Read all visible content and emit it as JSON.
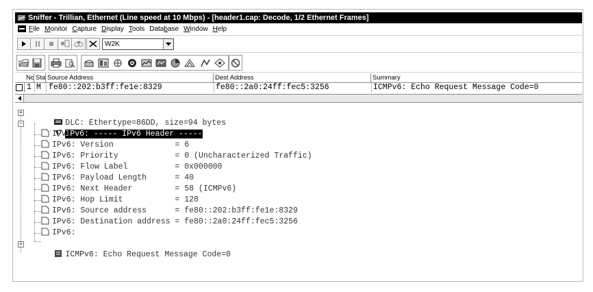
{
  "window": {
    "title": "Sniffer - Trillian, Ethernet (Line speed at 10 Mbps) - [header1.cap: Decode, 1/2 Ethernet Frames]"
  },
  "menu": {
    "items": [
      {
        "label": "File",
        "u": "F",
        "rest": "ile"
      },
      {
        "label": "Monitor",
        "u": "M",
        "rest": "onitor"
      },
      {
        "label": "Capture",
        "u": "C",
        "rest": "apture"
      },
      {
        "label": "Display",
        "u": "D",
        "rest": "isplay"
      },
      {
        "label": "Tools",
        "u": "T",
        "rest": "ools"
      },
      {
        "label": "Database",
        "pre": "Data",
        "u": "b",
        "rest": "ase"
      },
      {
        "label": "Window",
        "u": "W",
        "rest": "indow"
      },
      {
        "label": "Help",
        "u": "H",
        "rest": "elp"
      }
    ]
  },
  "toolbar": {
    "combo_value": "W2K"
  },
  "packet_list": {
    "columns": [
      "No.",
      "Stat",
      "Source Address",
      "Dest Address",
      "Summary"
    ],
    "rows": [
      {
        "no": "1",
        "status": "M",
        "source": "fe80::202:b3ff:fe1e:8329",
        "dest": "fe80::2a0:24ff:fec5:3256",
        "summary": "ICMPv6: Echo Request Message Code=0"
      }
    ]
  },
  "decode_tree": {
    "dlc": "DLC: Ethertype=86DD, size=94 bytes",
    "ipv6_header": "IPv6: ----- IPv6 Header -----",
    "fields": [
      "IPv6:",
      "IPv6: Version             = 6",
      "IPv6: Priority            = 0 (Uncharacterized Traffic)",
      "IPv6: Flow Label          = 0x000000",
      "IPv6: Payload Length      = 40",
      "IPv6: Next Header         = 58 (ICMPv6)",
      "IPv6: Hop Limit           = 128",
      "IPv6: Source address      = fe80::202:b3ff:fe1e:8329",
      "IPv6: Destination address = fe80::2a0:24ff:fec5:3256",
      "IPv6:"
    ],
    "icmpv6": "ICMPv6: Echo Request Message Code=0"
  }
}
